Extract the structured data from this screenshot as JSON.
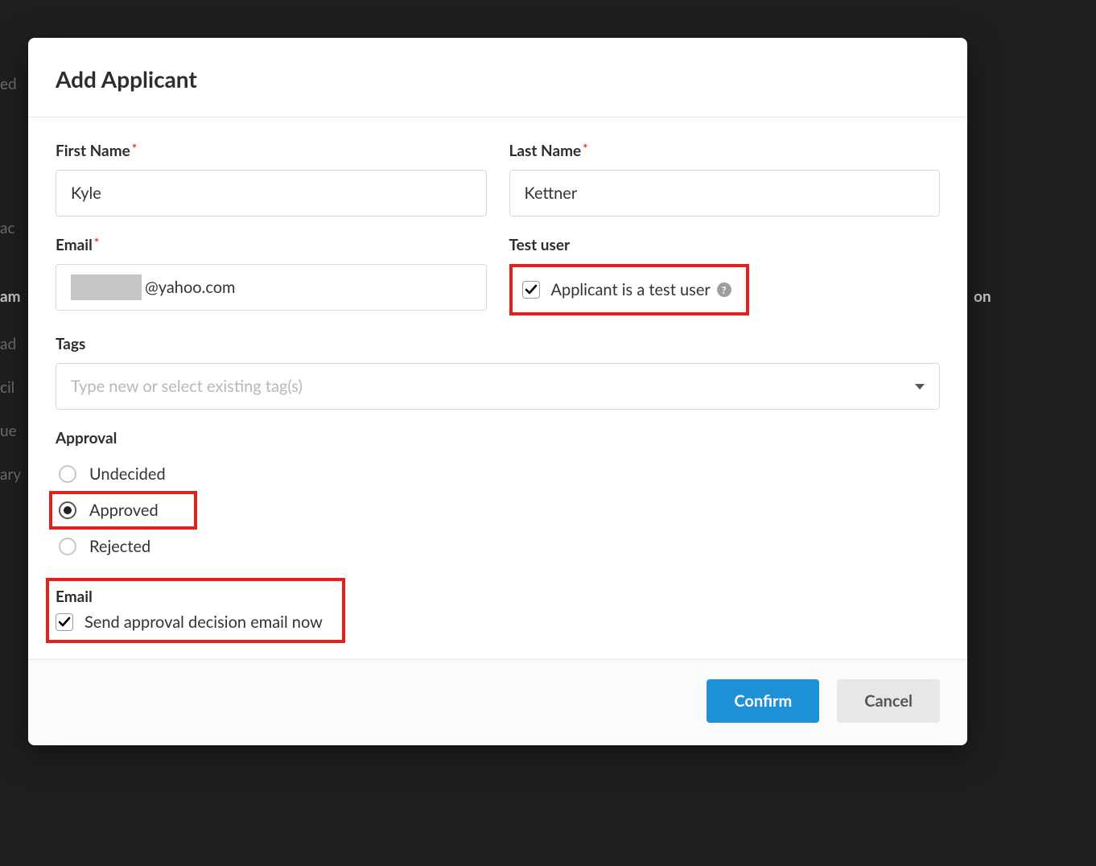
{
  "modal": {
    "title": "Add Applicant",
    "firstName": {
      "label": "First Name",
      "value": "Kyle",
      "required": "*"
    },
    "lastName": {
      "label": "Last Name",
      "value": "Kettner",
      "required": "*"
    },
    "email": {
      "label": "Email",
      "domain": "@yahoo.com",
      "required": "*"
    },
    "testUser": {
      "label": "Test user",
      "checkboxLabel": "Applicant is a test user",
      "helpGlyph": "?"
    },
    "tags": {
      "label": "Tags",
      "placeholder": "Type new or select existing tag(s)"
    },
    "approval": {
      "label": "Approval",
      "options": [
        "Undecided",
        "Approved",
        "Rejected"
      ],
      "selected": "Approved"
    },
    "sendEmail": {
      "label": "Email",
      "checkboxLabel": "Send approval decision email now"
    },
    "buttons": {
      "confirm": "Confirm",
      "cancel": "Cancel"
    }
  },
  "background": {
    "words": [
      "ed",
      "ac",
      "am",
      "on",
      "ad",
      "cil",
      "ue",
      "ary"
    ]
  }
}
